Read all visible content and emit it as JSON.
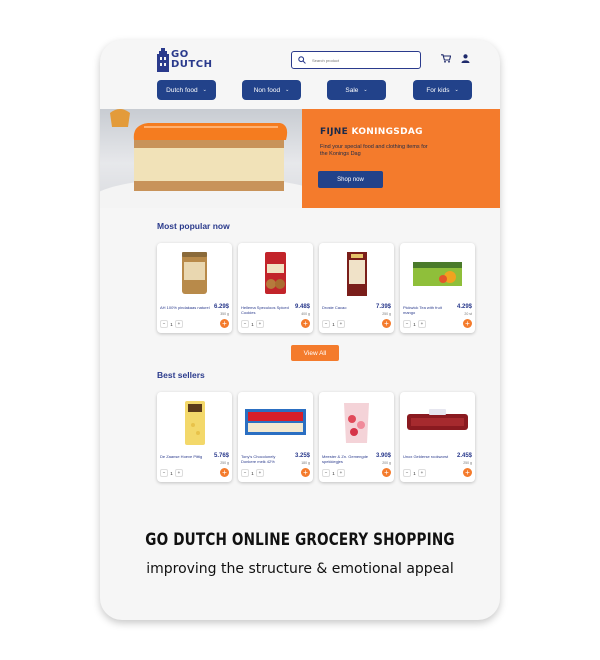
{
  "brand": {
    "line1": "GO",
    "line2": "DUTCH"
  },
  "search": {
    "placeholder": "Search product"
  },
  "nav": [
    {
      "label": "Dutch food"
    },
    {
      "label": "Non food"
    },
    {
      "label": "Sale"
    },
    {
      "label": "For kids"
    }
  ],
  "hero": {
    "title_part1": "FIJNE",
    "title_part2": "KONINGSDAG",
    "subtitle": "Find your special food and clothing items for the Konings Dag",
    "button": "Shop now"
  },
  "most_popular": {
    "title": "Most popular now",
    "items": [
      {
        "name": "AH 100% pindakaas naturel",
        "price": "6.29$",
        "weight": "350 g",
        "qty": "1"
      },
      {
        "name": "Hellema Speculoos Spiced Cookies",
        "price": "9.48$",
        "weight": "400 g",
        "qty": "1"
      },
      {
        "name": "Droste Cacao",
        "price": "7.39$",
        "weight": "250 g",
        "qty": "1"
      },
      {
        "name": "Pickwick Tea with fruit mango",
        "price": "4.29$",
        "weight": "20 st",
        "qty": "1"
      }
    ]
  },
  "view_all": "View All",
  "best_sellers": {
    "title": "Best sellers",
    "items": [
      {
        "name": "De Zaanse Hoeve Pittig",
        "price": "5.76$",
        "weight": "250 g",
        "qty": "1"
      },
      {
        "name": "Tony's Chocolonely Donkere melk 42%",
        "price": "3.25$",
        "weight": "180 g",
        "qty": "1"
      },
      {
        "name": "Meester & Zn. Gemengde spekkiegjes",
        "price": "3.90$",
        "weight": "200 g",
        "qty": "1"
      },
      {
        "name": "Unox Gelderse rookworst",
        "price": "2.45$",
        "weight": "250 g",
        "qty": "1"
      }
    ]
  },
  "caption": {
    "title": "GO DUTCH ONLINE GROCERY SHOPPING",
    "subtitle": "improving the structure & emotional appeal"
  },
  "colors": {
    "navy": "#22428a",
    "orange": "#f47b2c",
    "card_bg": "#f6f6f6"
  }
}
